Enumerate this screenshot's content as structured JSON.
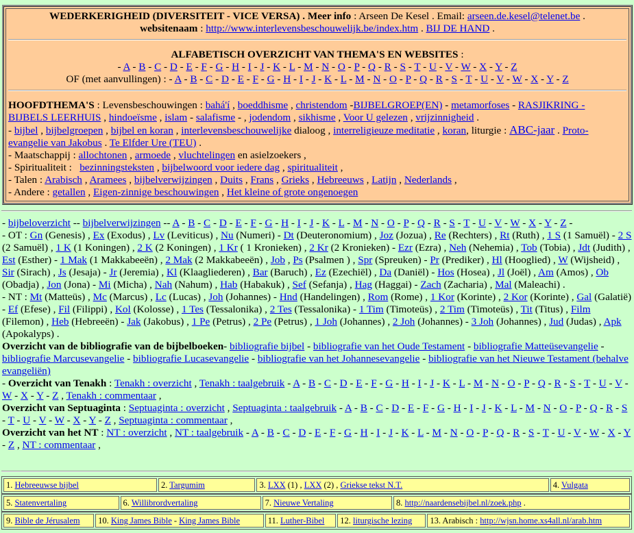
{
  "header": {
    "title": "WEDERKERIGHEID (DIVERSITEIT - VICE VERSA) . Meer info",
    "author": ": Arseen De Kesel . Email:",
    "email": "arseen.de.kesel@telenet.be",
    "sitename_label": "websitenaam",
    "site_url": "http://www.interlevensbeschouwelijk.be/index.htm",
    "bij_de_hand": "BIJ DE HAND"
  },
  "alpha": {
    "title": "ALFABETISCH OVERZICHT VAN THEMA'S EN WEBSITES",
    "letters": [
      "A",
      "B",
      "C",
      "D",
      "E",
      "F",
      "G",
      "H",
      "I",
      "J",
      "K",
      "L",
      "M",
      "N",
      "O",
      "P",
      "Q",
      "R",
      "S",
      "T",
      "U",
      "V",
      "W",
      "X",
      "Y",
      "Z"
    ],
    "of_label": "OF (met aanvullingen) : -"
  },
  "themes": {
    "title": "HOOFDTHEMA'S",
    "levens_label": ": Levensbeschouwingen :",
    "l_bahai": "bahá'í",
    "l_boeddhisme": "boeddhisme",
    "l_christendom": "christendom",
    "l_bijbelgroep": "BIJBELGROEP(EN)",
    "l_metamorfoses": "metamorfoses",
    "l_rasjikring": "RASJIKRING - BIJBELS LEERHUIS",
    "l_hindoeisme": "hindoeïsme",
    "l_islam": "islam",
    "l_salafisme": "salafisme",
    "l_jodendom": "jodendom",
    "l_sikhisme": "sikhisme",
    "l_vooru": "Voor U gelezen",
    "l_vrijzinnigheid": "vrijzinnigheid",
    "b_bijbel": "bijbel",
    "b_bijbelgroepen": "bijbelgroepen",
    "b_bijbelkoran": "bijbel en koran",
    "b_inter": "interlevensbeschouwelijke",
    "b_dialoog": "dialoog ,",
    "b_meditatie": "interreligieuze meditatie",
    "b_koran": "koran",
    "b_liturgie": ", liturgie :",
    "b_abc": "ABC-jaar",
    "b_proto": "Proto-evangelie van Jakobus",
    "b_elfder": "Te Elfder Ure (TEU)",
    "m_label": "- Maatschappij :",
    "m_allochtonen": "allochtonen",
    "m_armoede": "armoede",
    "m_vlucht": "vluchtelingen",
    "m_rest": "en asielzoekers ,",
    "s_label": "- Spiritualiteit :",
    "s_bez": "bezinningsteksten",
    "s_bijbelwoord": "bijbelwoord voor iedere dag",
    "s_spir": "spiritualiteit",
    "t_label": "- Talen :",
    "t_arabisch": "Arabisch",
    "t_arameês": "Aramees",
    "t_bijbelverw": "bijbelverwijzingen",
    "t_duits": "Duits",
    "t_frans": "Frans",
    "t_grieks": "Grieks",
    "t_hebr": "Hebreeuws",
    "t_latijn": "Latijn",
    "t_ned": "Nederlands",
    "a_label": "- Andere :",
    "a_getallen": "getallen",
    "a_eigen": "Eigen-zinnige beschouwingen",
    "a_klein": "Het kleine of grote ongenoegen"
  },
  "bible": {
    "overzicht": "bijbeloverzicht",
    "verwijzingen": "bijbelverwijzingen",
    "ot_label": "- OT :",
    "ot_books": [
      [
        "Gn",
        "(Genesis)"
      ],
      [
        "Ex",
        "(Exodus)"
      ],
      [
        "Lv",
        "(Leviticus)"
      ],
      [
        "Nu",
        "(Numeri)"
      ],
      [
        "Dt",
        "(Deuteronomium)"
      ],
      [
        "Joz",
        "(Jozua)"
      ],
      [
        "Re",
        "(Rechters)"
      ],
      [
        "Rt",
        "(Ruth)"
      ],
      [
        "1 S",
        "(1 Samuël)"
      ],
      [
        "2 S",
        "(2 Samuël)"
      ],
      [
        "1 K",
        "(1 Koningen)"
      ],
      [
        "2 K",
        "(2 Koningen)"
      ],
      [
        "1 Kr",
        "( 1 Kronieken)"
      ],
      [
        "2 Kr",
        "(2 Kronieken)"
      ],
      [
        "Ezr",
        "(Ezra)"
      ],
      [
        "Neh",
        "(Nehemia)"
      ],
      [
        "Tob",
        "(Tobia)"
      ],
      [
        "Jdt",
        "(Judith)"
      ],
      [
        "Est",
        "(Esther)"
      ],
      [
        "1 Mak",
        "(1 Makkabeeën)"
      ],
      [
        "2 Mak",
        "(2 Makkabeeën)"
      ],
      [
        "Job",
        ""
      ],
      [
        "Ps",
        "(Psalmen )"
      ],
      [
        "Spr",
        "(Spreuken)"
      ],
      [
        "Pr",
        "(Prediker)"
      ],
      [
        "Hl",
        "(Hooglied)"
      ],
      [
        "W",
        "(Wijsheid)"
      ],
      [
        "Sir",
        "(Sirach)"
      ],
      [
        "Js",
        "(Jesaja)"
      ],
      [
        "Jr",
        "(Jeremia)"
      ],
      [
        "Kl",
        "(Klaagliederen)"
      ],
      [
        "Bar",
        "(Baruch)"
      ],
      [
        "Ez",
        "(Ezechiël)"
      ],
      [
        "Da",
        "(Daniël)"
      ],
      [
        "Hos",
        "(Hosea)"
      ],
      [
        "Jl",
        "(Joël)"
      ],
      [
        "Am",
        "(Amos)"
      ],
      [
        "Ob",
        "(Obadja)"
      ],
      [
        "Jon",
        "(Jona)"
      ],
      [
        "Mi",
        "(Micha)"
      ],
      [
        "Nah",
        "(Nahum)"
      ],
      [
        "Hab",
        "(Habakuk)"
      ],
      [
        "Sef",
        "(Sefanja)"
      ],
      [
        "Hag",
        "(Haggai)"
      ],
      [
        "Zach",
        "(Zacharia)"
      ],
      [
        "Mal",
        "(Maleachi) ."
      ]
    ],
    "nt_label": "- NT :",
    "nt_books": [
      [
        "Mt",
        "(Matteüs)"
      ],
      [
        "Mc",
        "(Marcus)"
      ],
      [
        "Lc",
        "(Lucas)"
      ],
      [
        "Joh",
        "(Johannes)"
      ],
      [
        "Hnd",
        "(Handelingen)"
      ],
      [
        "Rom",
        "(Rome)"
      ],
      [
        "1 Kor",
        "(Korinte)"
      ],
      [
        "2 Kor",
        "(Korinte)"
      ],
      [
        "Gal",
        "(Galatië)"
      ],
      [
        "Ef",
        "(Efese)"
      ],
      [
        "Fil",
        "(Filippi)"
      ],
      [
        "Kol",
        "(Kolosse)"
      ],
      [
        "1 Tes",
        "(Tessalonika)"
      ],
      [
        "2 Tes",
        "(Tessalonika)"
      ],
      [
        "1 Tim",
        "(Timoteüs)"
      ],
      [
        "2 Tim",
        "(Timoteüs)"
      ],
      [
        "Tit",
        "(Titus)"
      ],
      [
        "Film",
        "(Filemon)"
      ],
      [
        "Heb",
        "(Hebreeën)"
      ],
      [
        "Jak",
        "(Jakobus)"
      ],
      [
        "1 Pe",
        "(Petrus)"
      ],
      [
        "2 Pe",
        "(Petrus)"
      ],
      [
        "1 Joh",
        "(Johannes)"
      ],
      [
        "2 Joh",
        "(Johannes)"
      ],
      [
        "3 Joh",
        "(Johannes)"
      ],
      [
        "Jud",
        "(Judas)"
      ],
      [
        "Apk",
        "(Apokalyps) ."
      ]
    ],
    "biblio_title": "Overzicht van de bibliografie van de bijbelboeken",
    "biblio_links": [
      "bibliografie bijbel",
      "bibliografie van het Oude Testament",
      "bibliografie Matteüsevangelie",
      "bibliografie Marcusevangelie",
      "bibliografie Lucasevangelie",
      "bibliografie van het Johannesevangelie",
      "bibliografie van het Nieuwe Testament (behalve evangeliën)"
    ],
    "tenakh_title": "Overzicht van Tenakh",
    "tenakh_overzicht": "Tenakh : overzicht",
    "tenakh_taal": "Tenakh : taalgebruik",
    "tenakh_comm": "Tenakh : commentaar",
    "sept_title": "Overzicht van Septuaginta",
    "sept_overzicht": "Septuaginta : overzicht",
    "sept_taal": "Septuaginta : taalgebruik",
    "sept_comm": "Septuaginta : commentaar",
    "nt_title": "Overzicht van het NT",
    "ntov_overzicht": "NT : overzicht",
    "ntov_taal": "NT : taalgebruik",
    "ntov_comm": "NT : commentaar"
  },
  "table": {
    "rows": [
      [
        {
          "n": "1.",
          "links": [
            "Hebreeuwse bijbel"
          ],
          "extra": ""
        },
        {
          "n": "2.",
          "links": [
            "Targumim"
          ],
          "extra": ""
        },
        {
          "n": "3.",
          "links": [
            "LXX",
            "LXX",
            "Griekse tekst N.T."
          ],
          "extra": ""
        },
        {
          "n": "4.",
          "links": [
            "Vulgata"
          ],
          "extra": ""
        }
      ],
      [
        {
          "n": "5.",
          "links": [
            "Statenvertaling"
          ],
          "extra": ""
        },
        {
          "n": "6.",
          "links": [
            "Willibrordvertaling"
          ],
          "extra": ""
        },
        {
          "n": "7.",
          "links": [
            "Nieuwe Vertaling"
          ],
          "extra": ""
        },
        {
          "n": "8.",
          "links": [
            "http://naardensebijbel.nl/zoek.php"
          ],
          "extra": " ."
        }
      ],
      [
        {
          "n": "9.",
          "links": [
            "Bible de Jérusalem"
          ],
          "extra": ""
        },
        {
          "n": "10.",
          "links": [
            "King James Bible",
            "King James Bible"
          ],
          "extra": ""
        },
        {
          "n": "11.",
          "links": [
            "Luther-Bibel"
          ],
          "extra": ""
        },
        {
          "n": "12.",
          "links": [
            "liturgische lezing"
          ],
          "extra": ""
        },
        {
          "n": "13. Arabisch :",
          "links": [
            "http://wjsn.home.xs4all.nl/arab.htm"
          ],
          "extra": ""
        }
      ]
    ]
  }
}
